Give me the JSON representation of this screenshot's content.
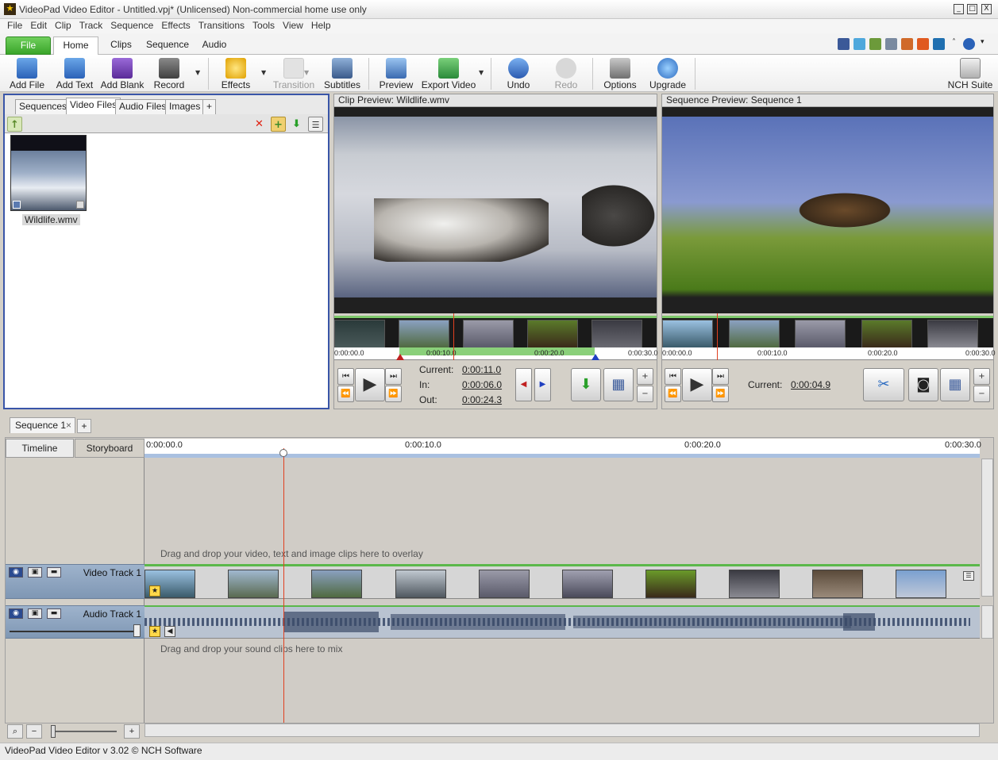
{
  "window": {
    "title": "VideoPad Video Editor - Untitled.vpj* (Unlicensed) Non-commercial home use only",
    "controls": [
      "_",
      "□",
      "X"
    ]
  },
  "menu": [
    "File",
    "Edit",
    "Clip",
    "Track",
    "Sequence",
    "Effects",
    "Transitions",
    "Tools",
    "View",
    "Help"
  ],
  "ribbon_tabs": {
    "file": "File",
    "home": "Home",
    "clips": "Clips",
    "sequence": "Sequence",
    "audio": "Audio"
  },
  "toolbar": {
    "add_file": "Add File",
    "add_text": "Add Text",
    "add_blank": "Add Blank",
    "record": "Record",
    "effects": "Effects",
    "transition": "Transition",
    "subtitles": "Subtitles",
    "preview": "Preview",
    "export_video": "Export Video",
    "undo": "Undo",
    "redo": "Redo",
    "options": "Options",
    "upgrade": "Upgrade",
    "nch_suite": "NCH Suite"
  },
  "bin": {
    "tabs": {
      "sequences": "Sequences",
      "video_files": "Video Files",
      "audio_files": "Audio Files",
      "images": "Images",
      "add": "+"
    },
    "clip_name": "Wildlife.wmv"
  },
  "clip_preview": {
    "title": "Clip Preview: Wildlife.wmv",
    "ruler": [
      "0:00:00.0",
      "0:00:10.0",
      "0:00:20.0",
      "0:00:30.0"
    ],
    "current_label": "Current:",
    "current": "0:00:11.0",
    "in_label": "In:",
    "in": "0:00:06.0",
    "out_label": "Out:",
    "out": "0:00:24.3"
  },
  "sequence_preview": {
    "title": "Sequence Preview: Sequence 1",
    "ruler": [
      "0:00:00.0",
      "0:00:10.0",
      "0:00:20.0",
      "0:00:30.0"
    ],
    "current_label": "Current:",
    "current": "0:00:04.9"
  },
  "sequence": {
    "tab": "Sequence 1",
    "tab_close": "×",
    "add": "+",
    "mode_timeline": "Timeline",
    "mode_storyboard": "Storyboard",
    "ruler": [
      "0:00:00.0",
      "0:00:10.0",
      "0:00:20.0",
      "0:00:30.0"
    ],
    "overlay_hint": "Drag and drop your video, text and image clips here to overlay",
    "video_track": "Video Track 1",
    "audio_track": "Audio Track 1",
    "sound_hint": "Drag and drop your sound clips here to mix"
  },
  "status": "VideoPad Video Editor v 3.02 © NCH Software"
}
